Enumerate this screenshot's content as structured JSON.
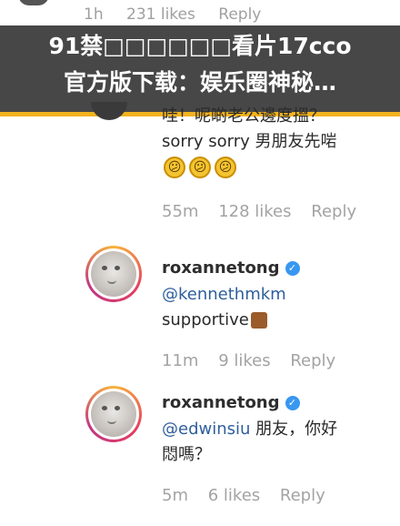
{
  "top_comment": {
    "time": "1h",
    "likes": "231 likes",
    "reply": "Reply"
  },
  "title_overlay": {
    "line1": "91禁□□□□□□看片17cco",
    "line2": "官方版下载：娱乐圈神秘…"
  },
  "comment1": {
    "line1": "哇！呢啲老公邊度搵？",
    "line2": "sorry sorry 男朋友先啱",
    "emoji": [
      "😕",
      "😕",
      "😕"
    ],
    "time": "55m",
    "likes": "128 likes",
    "reply": "Reply"
  },
  "comment2": {
    "username": "roxannetong",
    "mention": "@kennethmkm",
    "text": "supportive",
    "time": "11m",
    "likes": "9 likes",
    "reply": "Reply"
  },
  "comment3": {
    "username": "roxannetong",
    "mention": "@edwinsiu",
    "text_after_mention": " 朋友，你好",
    "line2": "悶嗎？",
    "time": "5m",
    "likes": "6 likes",
    "reply": "Reply"
  },
  "colors": {
    "overlay_border": "#f2b21e",
    "verified": "#3897f0",
    "mention": "#2f5f9c"
  }
}
